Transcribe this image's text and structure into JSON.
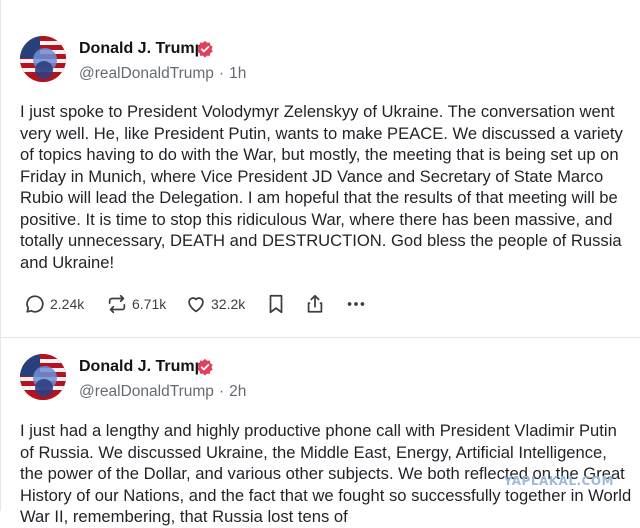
{
  "posts": [
    {
      "author": "Donald J. Trump",
      "handle": "@realDonaldTrump",
      "time": "1h",
      "text": "I just spoke to President Volodymyr Zelenskyy of Ukraine. The conversation went very well. He, like President Putin, wants to make PEACE. We discussed a variety of topics having to do with the War, but mostly, the meeting that is being set up on Friday in Munich, where Vice President JD Vance and Secretary of State Marco Rubio will lead the Delegation. I am hopeful that the results of that meeting will be positive. It is time to stop this ridiculous War, where there has been massive, and totally unnecessary, DEATH and DESTRUCTION. God bless the people of Russia and Ukraine!",
      "replies": "2.24k",
      "retruths": "6.71k",
      "likes": "32.2k"
    },
    {
      "author": "Donald J. Trump",
      "handle": "@realDonaldTrump",
      "time": "2h",
      "text": "I just had a lengthy and highly productive phone call with President Vladimir Putin of Russia. We discussed Ukraine, the Middle East, Energy, Artificial Intelligence, the power of the Dollar, and various other subjects. We both reflected on the Great History of our Nations, and the fact that we fought so successfully together in World War II, remembering, that Russia lost tens of"
    }
  ],
  "icons": {
    "verified": "verified-badge-icon",
    "reply": "reply-icon",
    "retruth": "retruth-icon",
    "like": "heart-icon",
    "bookmark": "bookmark-icon",
    "share": "share-icon",
    "more": "more-icon"
  },
  "watermark": "YAPLAKAL.COM",
  "colors": {
    "verified": "#e0405a",
    "text": "#1f2227",
    "secondary": "#666b73",
    "divider": "#e6e6e6",
    "watermark": "#9bbbd8"
  }
}
